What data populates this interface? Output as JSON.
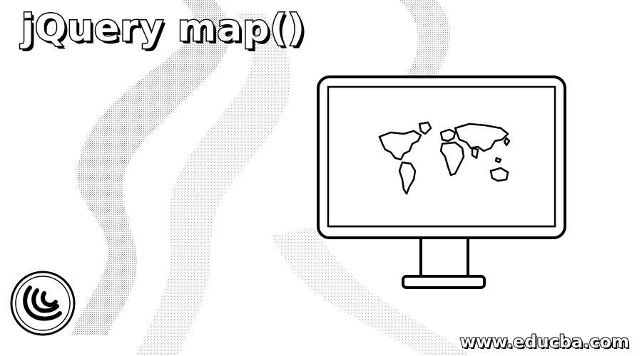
{
  "banner": {
    "title": "jQuery map()",
    "website": "www.educba.com"
  },
  "illustration": {
    "monitor_icon": "desktop-monitor-icon",
    "map_icon": "world-map-icon",
    "logo_icon": "jquery-logo-icon"
  },
  "colors": {
    "ink": "#000000",
    "paper": "#ffffff",
    "texture": "#9a9a9a"
  }
}
